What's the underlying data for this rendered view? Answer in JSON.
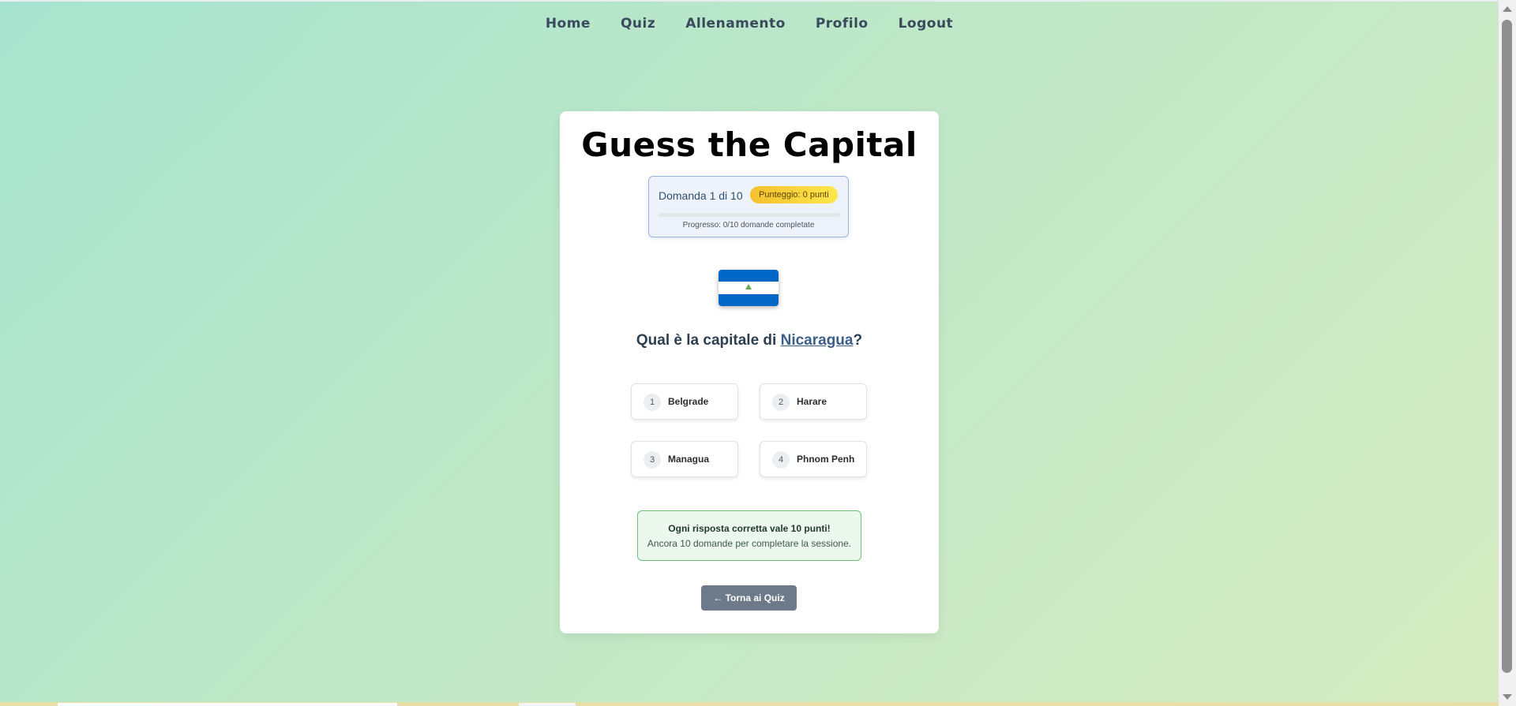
{
  "nav": {
    "items": [
      {
        "label": "Home"
      },
      {
        "label": "Quiz"
      },
      {
        "label": "Allenamento"
      },
      {
        "label": "Profilo"
      },
      {
        "label": "Logout"
      }
    ]
  },
  "quiz": {
    "title": "Guess the Capital",
    "question_counter": "Domanda 1 di 10",
    "score_badge": "Punteggio: 0 punti",
    "progress_fraction": 0,
    "progress_text": "Progresso: 0/10 domande completate",
    "flag": {
      "country": "Nicaragua",
      "colors": [
        "#0067c6",
        "#ffffff",
        "#0067c6"
      ],
      "emblem_color": "#6aa84f"
    },
    "question_prefix": "Qual è la capitale di ",
    "country_link": "Nicaragua",
    "question_suffix": "?",
    "options": [
      {
        "number": "1",
        "label": "Belgrade"
      },
      {
        "number": "2",
        "label": "Harare"
      },
      {
        "number": "3",
        "label": "Managua"
      },
      {
        "number": "4",
        "label": "Phnom Penh"
      }
    ],
    "info_title": "Ogni risposta corretta vale 10 punti!",
    "info_subtitle": "Ancora 10 domande per completare la sessione.",
    "back_button": "← Torna ai Quiz"
  },
  "colors": {
    "accent_blue": "#4c8bd6",
    "badge_yellow": "#f5c02e",
    "success_green": "#6cbf75",
    "button_gray": "#6c7a89"
  }
}
